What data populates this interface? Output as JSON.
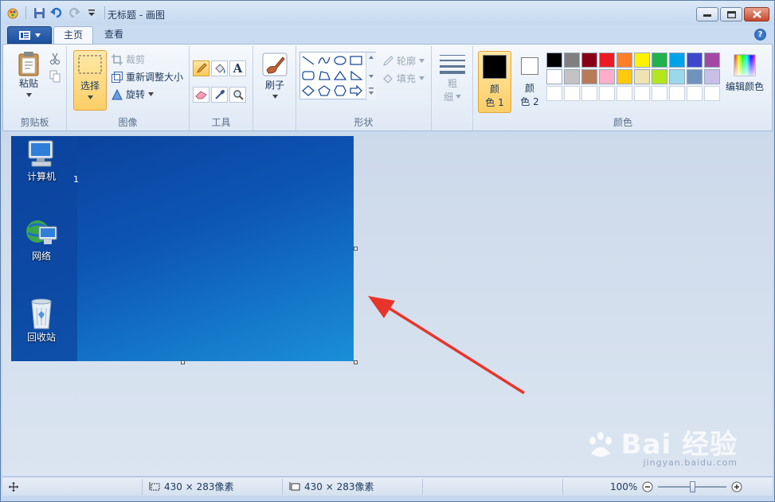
{
  "window": {
    "title": "无标题 - 画图"
  },
  "tabs": [
    {
      "label": "主页"
    },
    {
      "label": "查看"
    }
  ],
  "help_label": "?",
  "ribbon": {
    "clipboard": {
      "paste_label": "粘贴",
      "group_label": "剪贴板"
    },
    "image": {
      "select_label": "选择",
      "crop_label": "裁剪",
      "resize_label": "重新调整大小",
      "rotate_label": "旋转",
      "group_label": "图像"
    },
    "tools": {
      "text_tool_glyph": "A",
      "group_label": "工具"
    },
    "brushes": {
      "label": "刷子"
    },
    "shapes": {
      "outline_label": "轮廓",
      "fill_label": "填充",
      "group_label": "形状"
    },
    "size": {
      "label_top": "粗",
      "label_bottom": "细"
    },
    "colors": {
      "color1_label_top": "颜",
      "color1_label_bottom": "色 1",
      "color2_label_top": "颜",
      "color2_label_bottom": "色 2",
      "edit_colors_label": "编辑颜色",
      "group_label": "颜色",
      "color1_value": "#000000",
      "color2_value": "#ffffff",
      "palette_row1": [
        "#000000",
        "#7f7f7f",
        "#880015",
        "#ed1c24",
        "#ff7f27",
        "#fff200",
        "#22b14c",
        "#00a2e8",
        "#3f48cc",
        "#a349a4"
      ],
      "palette_row2": [
        "#ffffff",
        "#c3c3c3",
        "#b97a57",
        "#ffaec9",
        "#ffc90e",
        "#efe4b0",
        "#b5e61d",
        "#99d9ea",
        "#7092be",
        "#c8bfe7"
      ]
    }
  },
  "canvas": {
    "desktop_icons": [
      {
        "label": "计算机",
        "icon": "computer-icon"
      },
      {
        "label": "网络",
        "icon": "network-icon"
      },
      {
        "label": "回收站",
        "icon": "recycle-bin-icon"
      }
    ],
    "partial_text": "1"
  },
  "status": {
    "selection_size": "430 × 283像素",
    "image_size": "430 × 283像素",
    "zoom": "100%"
  },
  "watermark": {
    "main": "Bai 经验",
    "sub": "jingyan.baidu.com"
  },
  "accent_colors": {
    "arrow": "#e8352b",
    "selected_tool": "#fbce67"
  }
}
